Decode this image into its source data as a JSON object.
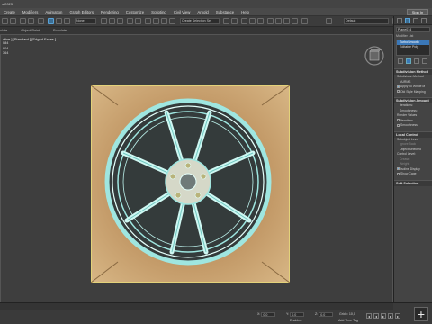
{
  "window": {
    "title": "s 2023"
  },
  "menu": [
    "Create",
    "Modifiers",
    "Animation",
    "Graph Editors",
    "Rendering",
    "Customize",
    "Scripting",
    "Civil View",
    "Arnold",
    "Substance",
    "Help"
  ],
  "signin": "Sign In",
  "toolbar": {
    "filter_value": "None",
    "selection_set": "Create Selection Se",
    "workspace": "Default"
  },
  "subbar": {
    "items": [
      "ulate",
      "Object Paint",
      "Populate"
    ]
  },
  "viewport": {
    "label": "ctive ] [Standard ] [Edged Faces ]",
    "stats": [
      "084",
      "904",
      "364"
    ]
  },
  "right": {
    "object_name": "Plane014",
    "modifier_list": "Modifier List",
    "stack": [
      {
        "label": "TurboSmooth",
        "selected": true
      },
      {
        "label": "Editable Poly",
        "selected": false
      }
    ],
    "rollouts": [
      {
        "title": "Subdivision Method",
        "lines": [
          {
            "text": "Subdivision Method",
            "type": "label"
          },
          {
            "text": "NURMS",
            "type": "field"
          },
          {
            "text": "Apply To Whole M",
            "type": "check",
            "on": true
          },
          {
            "text": "Old Style Mapping",
            "type": "check",
            "on": false
          }
        ]
      },
      {
        "title": "Subdivision Amount",
        "lines": [
          {
            "text": "Iterations:",
            "type": "label"
          },
          {
            "text": "Smoothness:",
            "type": "label"
          },
          {
            "text": "Render Values",
            "type": "label"
          },
          {
            "text": "Iterations",
            "type": "check",
            "on": false
          },
          {
            "text": "Smoothness",
            "type": "check",
            "on": false
          }
        ]
      },
      {
        "title": "Local Control",
        "lines": [
          {
            "text": "Subobject Level",
            "type": "label"
          },
          {
            "text": "Ignore Back",
            "type": "label"
          },
          {
            "text": "Object Selected",
            "type": "label"
          },
          {
            "text": "Control Level:",
            "type": "label"
          },
          {
            "text": "Crease:",
            "type": "label"
          },
          {
            "text": "Weight:",
            "type": "label"
          },
          {
            "text": "Isoline Display",
            "type": "check",
            "on": true
          },
          {
            "text": "Show Cage",
            "type": "check",
            "on": false
          }
        ]
      },
      {
        "title": "Soft Selection",
        "lines": []
      }
    ]
  },
  "status": {
    "x_label": "X:",
    "x_value": "0.0",
    "y_label": "Y:",
    "y_value": "0.0",
    "z_label": "Z:",
    "z_value": "0.0",
    "grid": "Grid = 10,0",
    "add_time_tag": "Add Time Tag",
    "enabled": "Enabled:"
  },
  "colors": {
    "accent": "#3b78b8",
    "wire": "#9fe6e0"
  }
}
